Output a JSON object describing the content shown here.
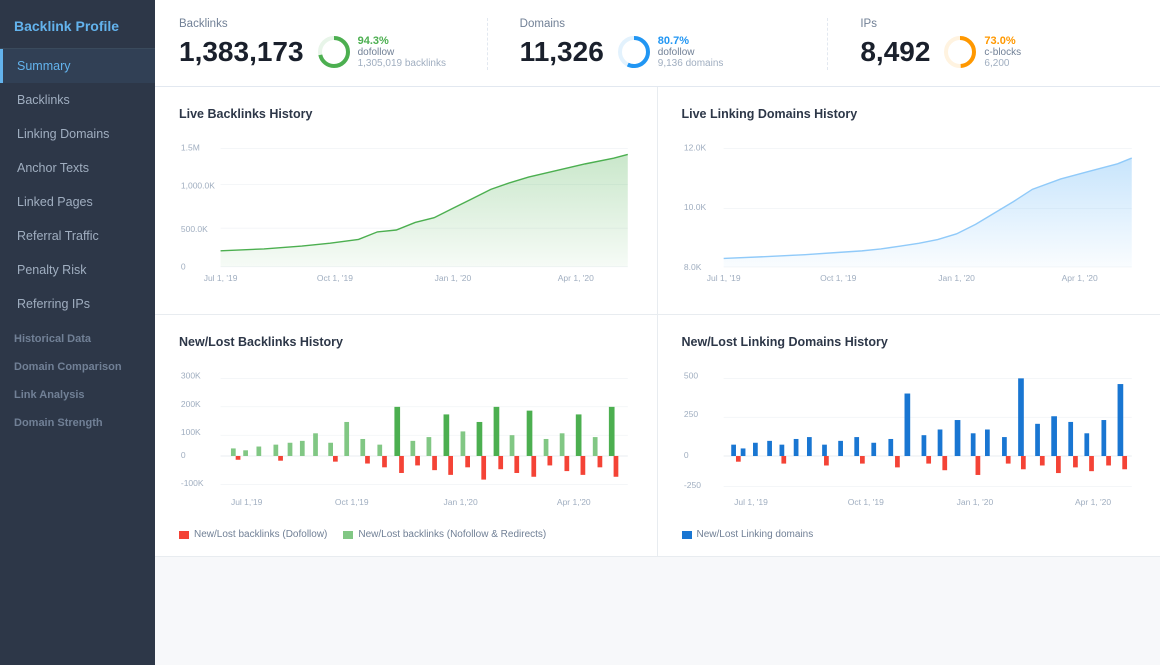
{
  "sidebar": {
    "title": "Backlink Profile",
    "items": [
      {
        "id": "summary",
        "label": "Summary",
        "active": true
      },
      {
        "id": "backlinks",
        "label": "Backlinks",
        "active": false
      },
      {
        "id": "linking-domains",
        "label": "Linking Domains",
        "active": false
      },
      {
        "id": "anchor-texts",
        "label": "Anchor Texts",
        "active": false
      },
      {
        "id": "linked-pages",
        "label": "Linked Pages",
        "active": false
      },
      {
        "id": "referral-traffic",
        "label": "Referral Traffic",
        "active": false
      },
      {
        "id": "penalty-risk",
        "label": "Penalty Risk",
        "active": false
      },
      {
        "id": "referring-ips",
        "label": "Referring IPs",
        "active": false
      }
    ],
    "sections": [
      {
        "label": "Historical Data",
        "items": []
      },
      {
        "label": "Domain Comparison",
        "items": []
      },
      {
        "label": "Link Analysis",
        "items": []
      },
      {
        "label": "Domain Strength",
        "items": []
      }
    ]
  },
  "stats": {
    "backlinks": {
      "label": "Backlinks",
      "value": "1,383,173",
      "percent": "94.3%",
      "desc": "dofollow",
      "sub": "1,305,019 backlinks",
      "donut_pct": 94.3,
      "color": "#4caf50"
    },
    "domains": {
      "label": "Domains",
      "value": "11,326",
      "percent": "80.7%",
      "desc": "dofollow",
      "sub": "9,136 domains",
      "donut_pct": 80.7,
      "color": "#2196f3"
    },
    "ips": {
      "label": "IPs",
      "value": "8,492",
      "percent": "73.0%",
      "desc": "c-blocks",
      "sub": "6,200",
      "donut_pct": 73.0,
      "color": "#ff9800"
    }
  },
  "charts": {
    "live_backlinks": {
      "title": "Live Backlinks History",
      "y_labels": [
        "1.5M",
        "1,000.0K",
        "500.0K",
        "0"
      ],
      "x_labels": [
        "Jul 1, '19",
        "Oct 1, '19",
        "Jan 1, '20",
        "Apr 1, '20"
      ],
      "color": "#4caf50"
    },
    "live_domains": {
      "title": "Live Linking Domains History",
      "y_labels": [
        "12.0K",
        "10.0K",
        "8.0K"
      ],
      "x_labels": [
        "Jul 1, '19",
        "Oct 1, '19",
        "Jan 1, '20",
        "Apr 1, '20"
      ],
      "color": "#90caf9"
    },
    "new_lost_backlinks": {
      "title": "New/Lost Backlinks History",
      "y_labels": [
        "300K",
        "200K",
        "100K",
        "0",
        "-100K"
      ],
      "x_labels": [
        "Jul 1,'19",
        "Oct 1,'19",
        "Jan 1,'20",
        "Apr 1,'20"
      ],
      "legend": [
        {
          "label": "New/Lost backlinks (Dofollow)",
          "color": "#f44336",
          "type": "sq"
        },
        {
          "label": "New/Lost backlinks (Nofollow & Redirects)",
          "color": "#81c784",
          "type": "sq"
        }
      ]
    },
    "new_lost_domains": {
      "title": "New/Lost Linking Domains History",
      "y_labels": [
        "500",
        "250",
        "0",
        "-250"
      ],
      "x_labels": [
        "Jul 1, '19",
        "Oct 1, '19",
        "Jan 1, '20",
        "Apr 1, '20"
      ],
      "legend": [
        {
          "label": "New/Lost Linking domains",
          "color": "#1976d2",
          "type": "sq"
        }
      ]
    }
  }
}
